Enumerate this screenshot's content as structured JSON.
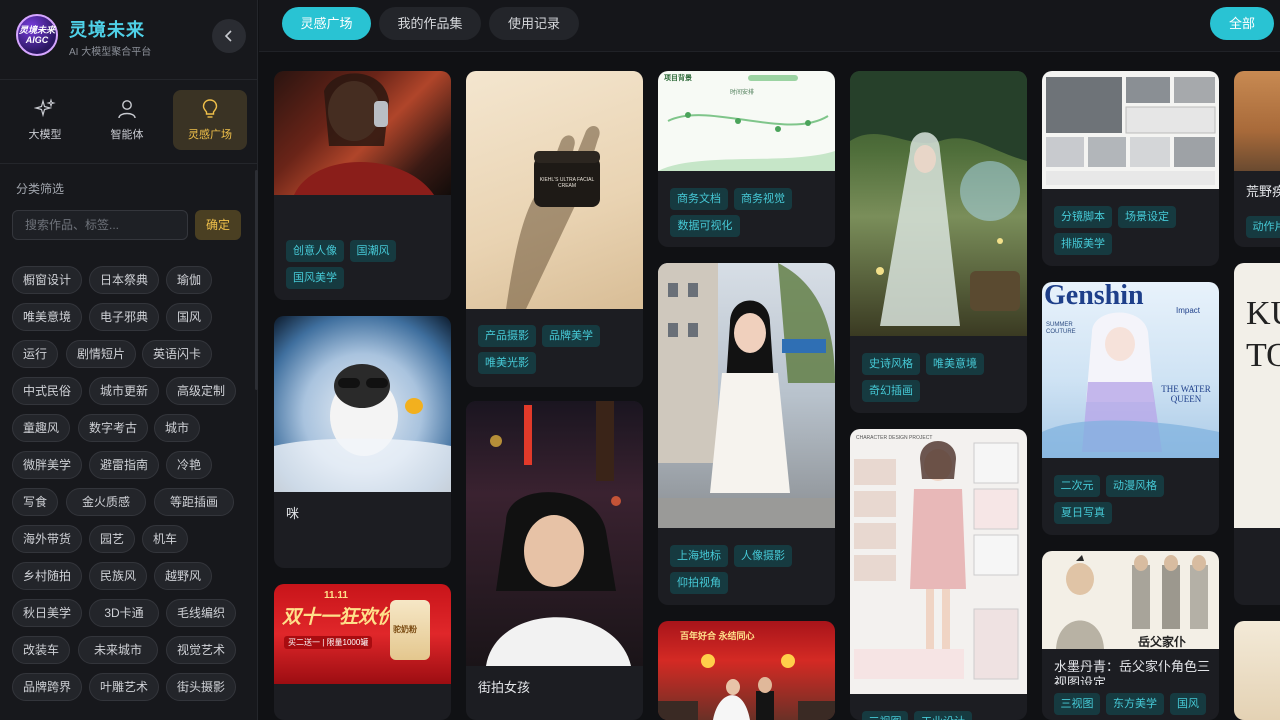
{
  "brand": {
    "logo_text_1": "灵境未来",
    "logo_text_2": "AIGC",
    "title": "灵境未来",
    "subtitle": "AI 大模型聚合平台"
  },
  "icons": {
    "collapse": "chevron-left-icon",
    "model": "sparkles-icon",
    "agent": "user-icon",
    "inspiration": "lightbulb-icon"
  },
  "modes": [
    {
      "label": "大模型"
    },
    {
      "label": "智能体"
    },
    {
      "label": "灵感广场"
    }
  ],
  "filter": {
    "title": "分类筛选",
    "placeholder": "搜索作品、标签...",
    "confirm": "确定"
  },
  "tags": [
    "橱窗设计",
    "日本祭典",
    "瑜伽",
    "唯美意境",
    "电子邪典",
    "国风",
    "运行",
    "剧情短片",
    "英语闪卡",
    "中式民俗",
    "城市更新",
    "高级定制",
    "童趣风",
    "数字考古",
    "城市",
    "微胖美学",
    "避雷指南",
    "冷艳",
    "写食",
    "金火质感",
    "等距插画",
    "海外带货",
    "园艺",
    "机车",
    "乡村随拍",
    "民族风",
    "越野风",
    "秋日美学",
    "3D卡通",
    "毛线编织",
    "改装车",
    "未来城市",
    "视觉艺术",
    "品牌跨界",
    "叶雕艺术",
    "街头摄影"
  ],
  "topbar": {
    "tabs": [
      "灵感广场",
      "我的作品集",
      "使用记录"
    ],
    "all": "全部"
  },
  "colors": {
    "accent": "#29c3d3",
    "gold": "#f0c04a",
    "chip_bg": "#163a40",
    "chip_text": "#46c9d6"
  },
  "cards": {
    "c1": {
      "chips": [
        "创意人像",
        "国潮风",
        "国风美学"
      ]
    },
    "c2": {
      "title": "咪"
    },
    "c3": {
      "banner_top": "11.11",
      "banner_main": "双十一狂欢价",
      "banner_sub": "买二送一 | 限量1000罐",
      "product": "驼奶粉"
    },
    "c4": {
      "product": "KIEHL'S ULTRA FACIAL CREAM",
      "chips": [
        "产品摄影",
        "品牌美学",
        "唯美光影"
      ]
    },
    "c5": {
      "title": "街拍女孩"
    },
    "c6": {
      "header": "项目背景",
      "subhead": "时间安排",
      "chips": [
        "商务文档",
        "商务视觉",
        "数据可视化"
      ]
    },
    "c7": {
      "chips": [
        "上海地标",
        "人像摄影",
        "仰拍视角"
      ]
    },
    "c8": {
      "banner": "百年好合 永结同心"
    },
    "c9": {
      "chips": [
        "史诗风格",
        "唯美意境",
        "奇幻插画"
      ]
    },
    "c10": {
      "header": "CHARACTER DESIGN PROJECT",
      "chips": [
        "三视图",
        "工业设计"
      ]
    },
    "c11": {
      "chips": [
        "分镜脚本",
        "场景设定",
        "排版美学"
      ]
    },
    "c12": {
      "mast": "Genshin",
      "mast_sub": "Impact",
      "cover_line": "THE WATER QUEEN",
      "cover_left": "SUMMER COUTURE",
      "chips": [
        "二次元",
        "动漫风格",
        "夏日写真"
      ]
    },
    "c13": {
      "sign": "岳父家仆",
      "title": "水墨丹青：岳父家仆角色三视图设定",
      "chips": [
        "三视图",
        "东方美学",
        "国风"
      ]
    },
    "c14": {
      "title": "荒野疾",
      "chips": [
        "动作片"
      ]
    },
    "c15": {
      "text": "KU TO"
    }
  }
}
